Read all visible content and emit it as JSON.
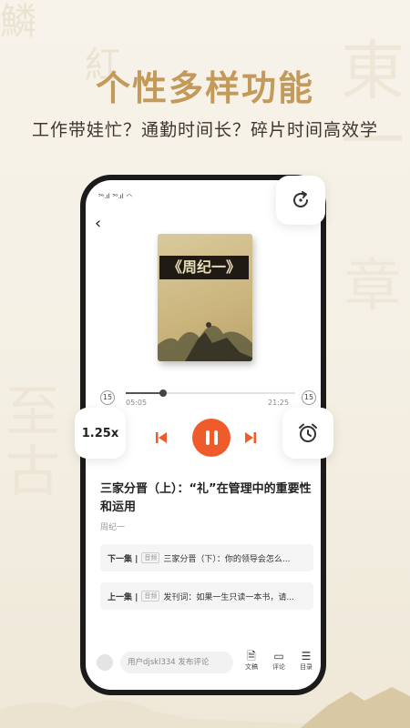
{
  "headline": "个性多样功能",
  "subline": "工作带娃忙？通勤时间长？碎片时间高效学",
  "status": {
    "signal1": "⁵ᴳ.ıl",
    "signal2": "⁵ᴳ.ıl",
    "wifi": "◠"
  },
  "player": {
    "book_title": "《周纪一》",
    "current_time": "05:05",
    "total_time": "21:25",
    "progress": 0.22,
    "skip_back": "15",
    "skip_forward": "15",
    "speed": "1.25x",
    "track_title": "三家分晋（上）：“礼”在管理中的重要性和运用",
    "album": "周纪一"
  },
  "episodes": {
    "next": {
      "label": "下一集 |",
      "tag": "音频",
      "title": "三家分晋（下）：你的领导会怎么..."
    },
    "prev": {
      "label": "上一集 |",
      "tag": "音频",
      "title": "发刊词：如果一生只读一本书，请..."
    }
  },
  "bottom": {
    "comment_placeholder": "用户djskl334 发布评论",
    "doc_label": "文稿",
    "comment_label": "评论",
    "toc_label": "目录"
  },
  "colors": {
    "accent": "#ef5b2a",
    "headline": "#c49a5b"
  }
}
